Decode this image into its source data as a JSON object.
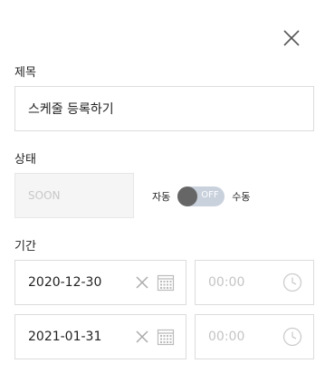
{
  "form": {
    "title_label": "제목",
    "title_value": "스케줄 등록하기",
    "status_label": "상태",
    "status_value": "SOON",
    "toggle_left_label": "자동",
    "toggle_state": "OFF",
    "toggle_right_label": "수동",
    "period_label": "기간",
    "start_date": "2020-12-30",
    "start_time_placeholder": "00:00",
    "end_date": "2021-01-31",
    "end_time_placeholder": "00:00"
  },
  "icons": [
    "close-icon",
    "clear-icon",
    "calendar-icon",
    "clock-icon"
  ]
}
